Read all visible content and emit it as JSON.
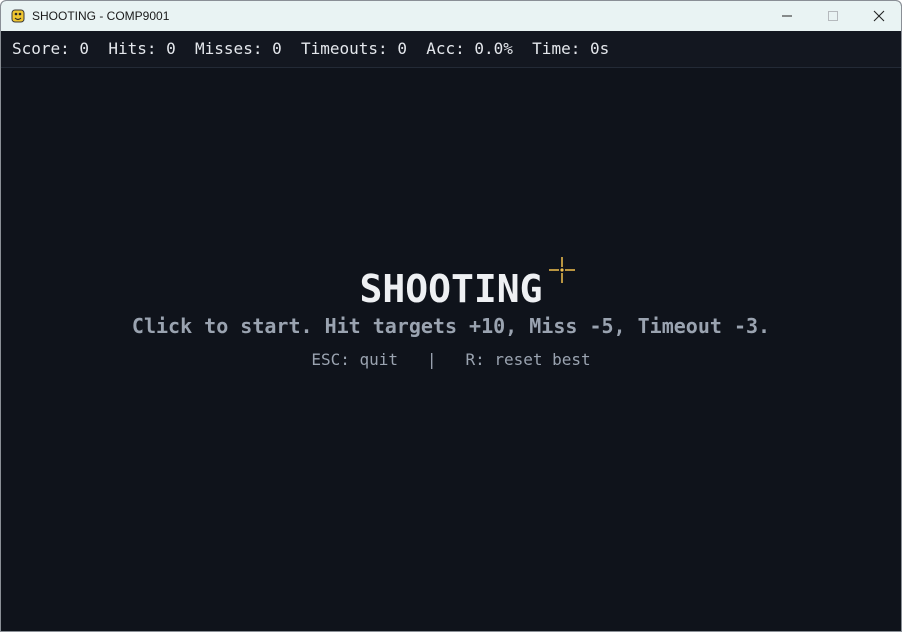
{
  "window": {
    "title": "SHOOTING - COMP9001",
    "icon": "pygame-snake-icon"
  },
  "controls_buttons": {
    "minimize_icon": "minimize-icon",
    "maximize_icon": "maximize-icon",
    "close_icon": "close-icon"
  },
  "hud": {
    "text": "Score: 0  Hits: 0  Misses: 0  Timeouts: 0  Acc: 0.0%  Time: 0s",
    "score": 0,
    "hits": 0,
    "misses": 0,
    "timeouts": 0,
    "accuracy": "0.0%",
    "time": "0s"
  },
  "screen": {
    "title": "SHOOTING",
    "instructions": "Click to start. Hit targets +10, Miss -5, Timeout -3.",
    "controls": "ESC: quit   |   R: reset best"
  },
  "cursor": {
    "icon": "crosshair-icon",
    "color": "#f2c14e"
  },
  "colors": {
    "background": "#0f131b",
    "hud_background": "#131720",
    "title": "#eef0f3",
    "muted_text": "#9aa3b0",
    "titlebar": "#e9f3f3"
  }
}
